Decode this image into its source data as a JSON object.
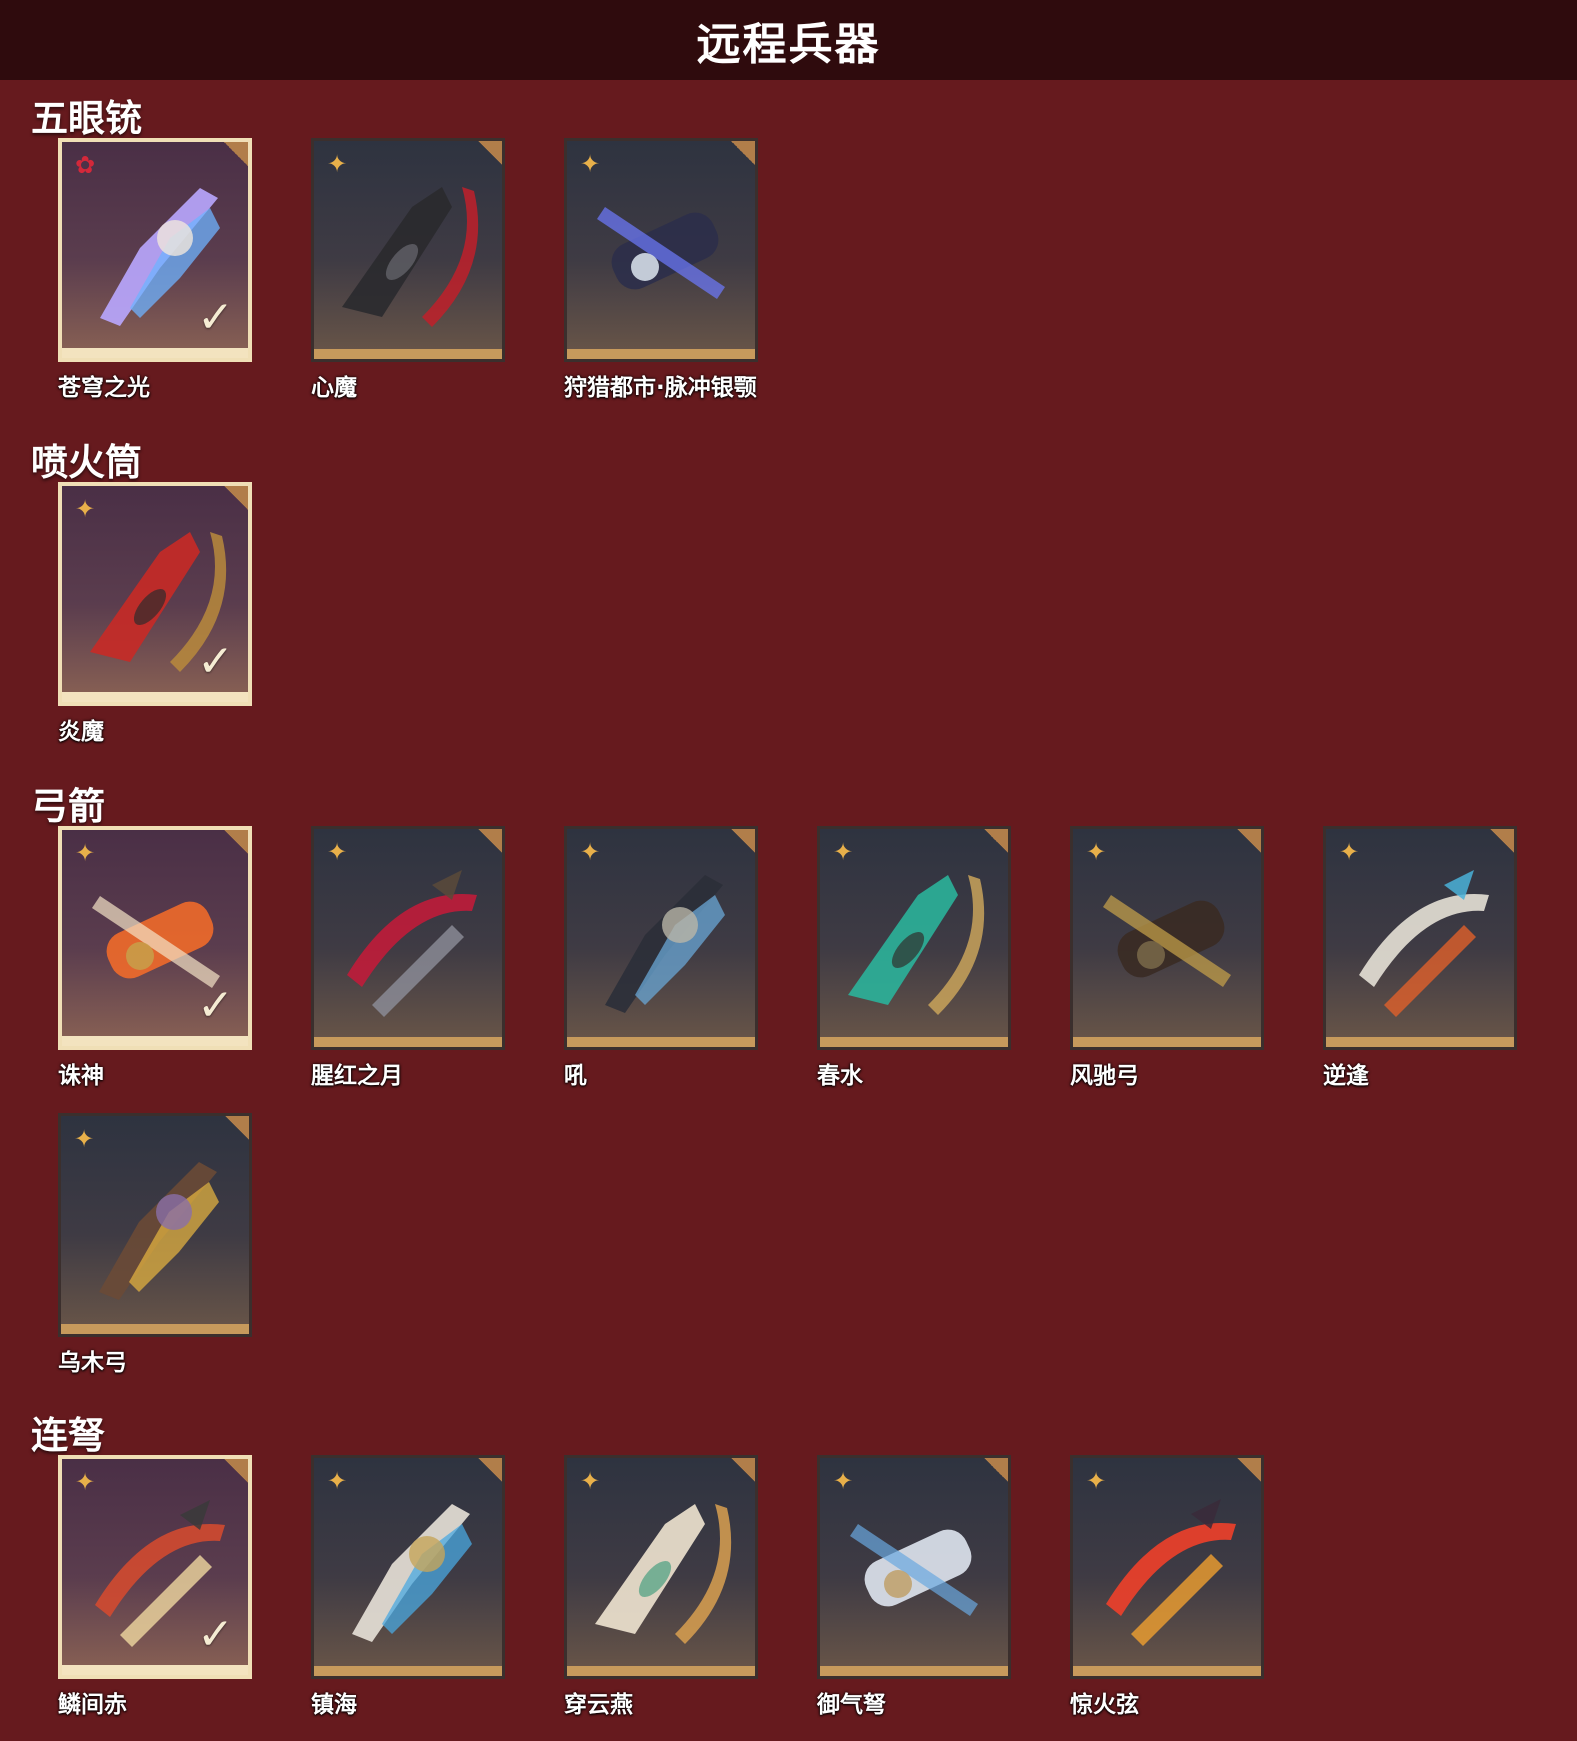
{
  "header": {
    "title": "远程兵器"
  },
  "sections": [
    {
      "title": "五眼铳",
      "items": [
        {
          "name": "苍穹之光",
          "selected": true,
          "rank_icon": "red-flower-icon",
          "colors": [
            "#b9a7ff",
            "#6fb3ff",
            "#f0e6dc"
          ]
        },
        {
          "name": "心魔",
          "selected": false,
          "rank_icon": "gold-star-icon",
          "colors": [
            "#2a2a2e",
            "#c0202a",
            "#6a6a70"
          ]
        },
        {
          "name": "狩猎都市·脉冲银颚",
          "selected": false,
          "rank_icon": "gold-star-icon",
          "colors": [
            "#2c2f4a",
            "#6d7bff",
            "#dde6f0"
          ]
        }
      ]
    },
    {
      "title": "喷火筒",
      "items": [
        {
          "name": "炎魔",
          "selected": true,
          "rank_icon": "gold-star-icon",
          "colors": [
            "#c82a26",
            "#b88a3c",
            "#2f2b2c"
          ]
        }
      ]
    },
    {
      "title": "弓箭",
      "items": [
        {
          "name": "诛神",
          "selected": true,
          "rank_icon": "gold-star-icon",
          "colors": [
            "#f06a2a",
            "#f3e2c6",
            "#c7a04a"
          ]
        },
        {
          "name": "腥红之月",
          "selected": false,
          "rank_icon": "gold-star-icon",
          "colors": [
            "#c01c3a",
            "#8d8f9a",
            "#5a4a3a"
          ]
        },
        {
          "name": "吼",
          "selected": false,
          "rank_icon": "gold-star-icon",
          "colors": [
            "#2b2f38",
            "#6aa7d6",
            "#b9b5a8"
          ]
        },
        {
          "name": "春水",
          "selected": false,
          "rank_icon": "gold-star-icon",
          "colors": [
            "#2bb39a",
            "#c9a35a",
            "#30302e"
          ]
        },
        {
          "name": "风驰弓",
          "selected": false,
          "rank_icon": "gold-star-icon",
          "colors": [
            "#3a2b24",
            "#c9a44a",
            "#7a6a4a"
          ]
        },
        {
          "name": "逆逢",
          "selected": false,
          "rank_icon": "gold-star-icon",
          "colors": [
            "#e6e1d6",
            "#e0602a",
            "#4ab2d8"
          ]
        },
        {
          "name": "乌木弓",
          "selected": false,
          "rank_icon": "gold-star-icon",
          "colors": [
            "#6a4a36",
            "#e0b040",
            "#8a6fa8"
          ]
        }
      ]
    },
    {
      "title": "连弩",
      "items": [
        {
          "name": "鳞间赤",
          "selected": true,
          "rank_icon": "gold-star-icon",
          "colors": [
            "#d24a30",
            "#f0d8a0",
            "#3a3a3a"
          ]
        },
        {
          "name": "镇海",
          "selected": false,
          "rank_icon": "gold-star-icon",
          "colors": [
            "#e8e2d8",
            "#4aa8e0",
            "#c5a55a"
          ]
        },
        {
          "name": "穿云燕",
          "selected": false,
          "rank_icon": "gold-star-icon",
          "colors": [
            "#efe4d0",
            "#d9a050",
            "#4aa080"
          ]
        },
        {
          "name": "御气弩",
          "selected": false,
          "rank_icon": "gold-star-icon",
          "colors": [
            "#dfe6f0",
            "#6aa8e0",
            "#c0a06a"
          ]
        },
        {
          "name": "惊火弦",
          "selected": false,
          "rank_icon": "gold-star-icon",
          "colors": [
            "#f0402a",
            "#f0a030",
            "#3a2a3a"
          ]
        }
      ]
    }
  ]
}
